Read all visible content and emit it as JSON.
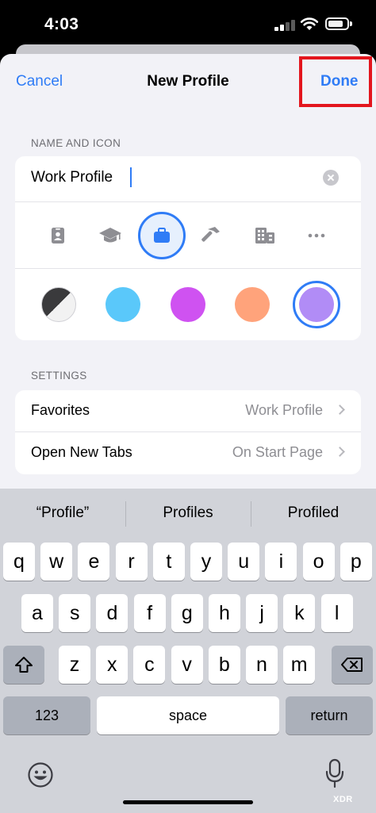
{
  "status_bar": {
    "time": "4:03"
  },
  "nav": {
    "cancel": "Cancel",
    "title": "New Profile",
    "done": "Done"
  },
  "name_section": {
    "header": "NAME AND ICON",
    "name_value": "Work Profile",
    "icons": [
      "person-badge-icon",
      "graduation-cap-icon",
      "briefcase-icon",
      "hammer-icon",
      "building-icon",
      "more-icon"
    ],
    "selected_icon": "briefcase-icon",
    "colors": [
      "#3a3a3c",
      "#5ac8fa",
      "#cf52f1",
      "#ffa37b",
      "#b18cf6"
    ],
    "selected_color": "#b18cf6"
  },
  "settings_section": {
    "header": "SETTINGS",
    "rows": [
      {
        "label": "Favorites",
        "value": "Work Profile"
      },
      {
        "label": "Open New Tabs",
        "value": "On Start Page"
      }
    ]
  },
  "keyboard": {
    "suggestions": [
      "“Profile”",
      "Profiles",
      "Profiled"
    ],
    "row1": [
      "q",
      "w",
      "e",
      "r",
      "t",
      "y",
      "u",
      "i",
      "o",
      "p"
    ],
    "row2": [
      "a",
      "s",
      "d",
      "f",
      "g",
      "h",
      "j",
      "k",
      "l"
    ],
    "row3": [
      "z",
      "x",
      "c",
      "v",
      "b",
      "n",
      "m"
    ],
    "numbers_key": "123",
    "space_key": "space",
    "return_key": "return"
  },
  "watermark": "XDR"
}
